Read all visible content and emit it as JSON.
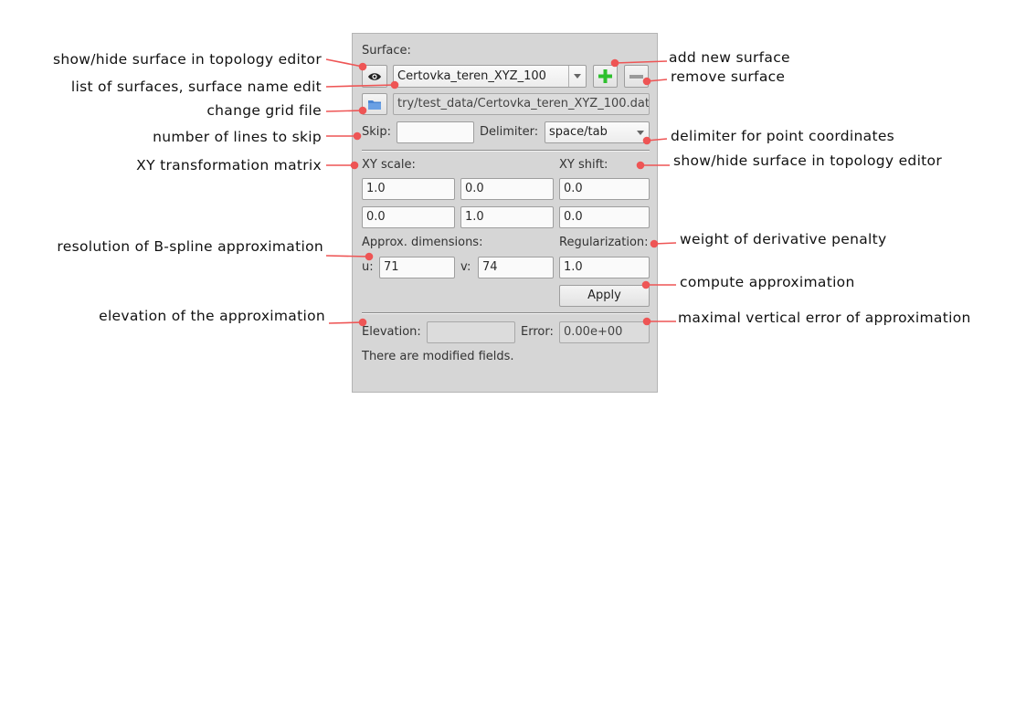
{
  "panel": {
    "surface_label": "Surface:",
    "surface_name": "Certovka_teren_XYZ_100",
    "file_path": "try/test_data/Certovka_teren_XYZ_100.dat",
    "skip_label": "Skip:",
    "skip_value": "",
    "delimiter_label": "Delimiter:",
    "delimiter_value": "space/tab",
    "xy_scale_label": "XY scale:",
    "xy_shift_label": "XY shift:",
    "matrix": [
      [
        "1.0",
        "0.0",
        "0.0"
      ],
      [
        "0.0",
        "1.0",
        "0.0"
      ]
    ],
    "approx_dim_label": "Approx. dimensions:",
    "regularization_label": "Regularization:",
    "u_label": "u:",
    "u_value": "71",
    "v_label": "v:",
    "v_value": "74",
    "regularization_value": "1.0",
    "apply_label": "Apply",
    "elevation_label": "Elevation:",
    "elevation_value": "",
    "error_label": "Error:",
    "error_value": "0.00e+00",
    "status_text": "There are modified fields."
  },
  "annotations": {
    "show_hide_left": "show/hide surface in topology editor",
    "list_surfaces": "list of surfaces, surface name edit",
    "change_grid": "change grid file",
    "lines_skip": "number of lines to skip",
    "xy_matrix": "XY transformation matrix",
    "resolution": "resolution of B-spline approximation",
    "elevation": "elevation of the approximation",
    "add_surface": "add new surface",
    "remove_surface": "remove surface",
    "delimiter": "delimiter for point coordinates",
    "show_hide_right": "show/hide surface in topology editor",
    "weight": "weight of derivative penalty",
    "compute": "compute approximation",
    "max_error": "maximal vertical error of approximation"
  },
  "colors": {
    "annotation_red": "#ee5555",
    "add_green": "#2ec02e",
    "folder_blue": "#4a86d4"
  }
}
